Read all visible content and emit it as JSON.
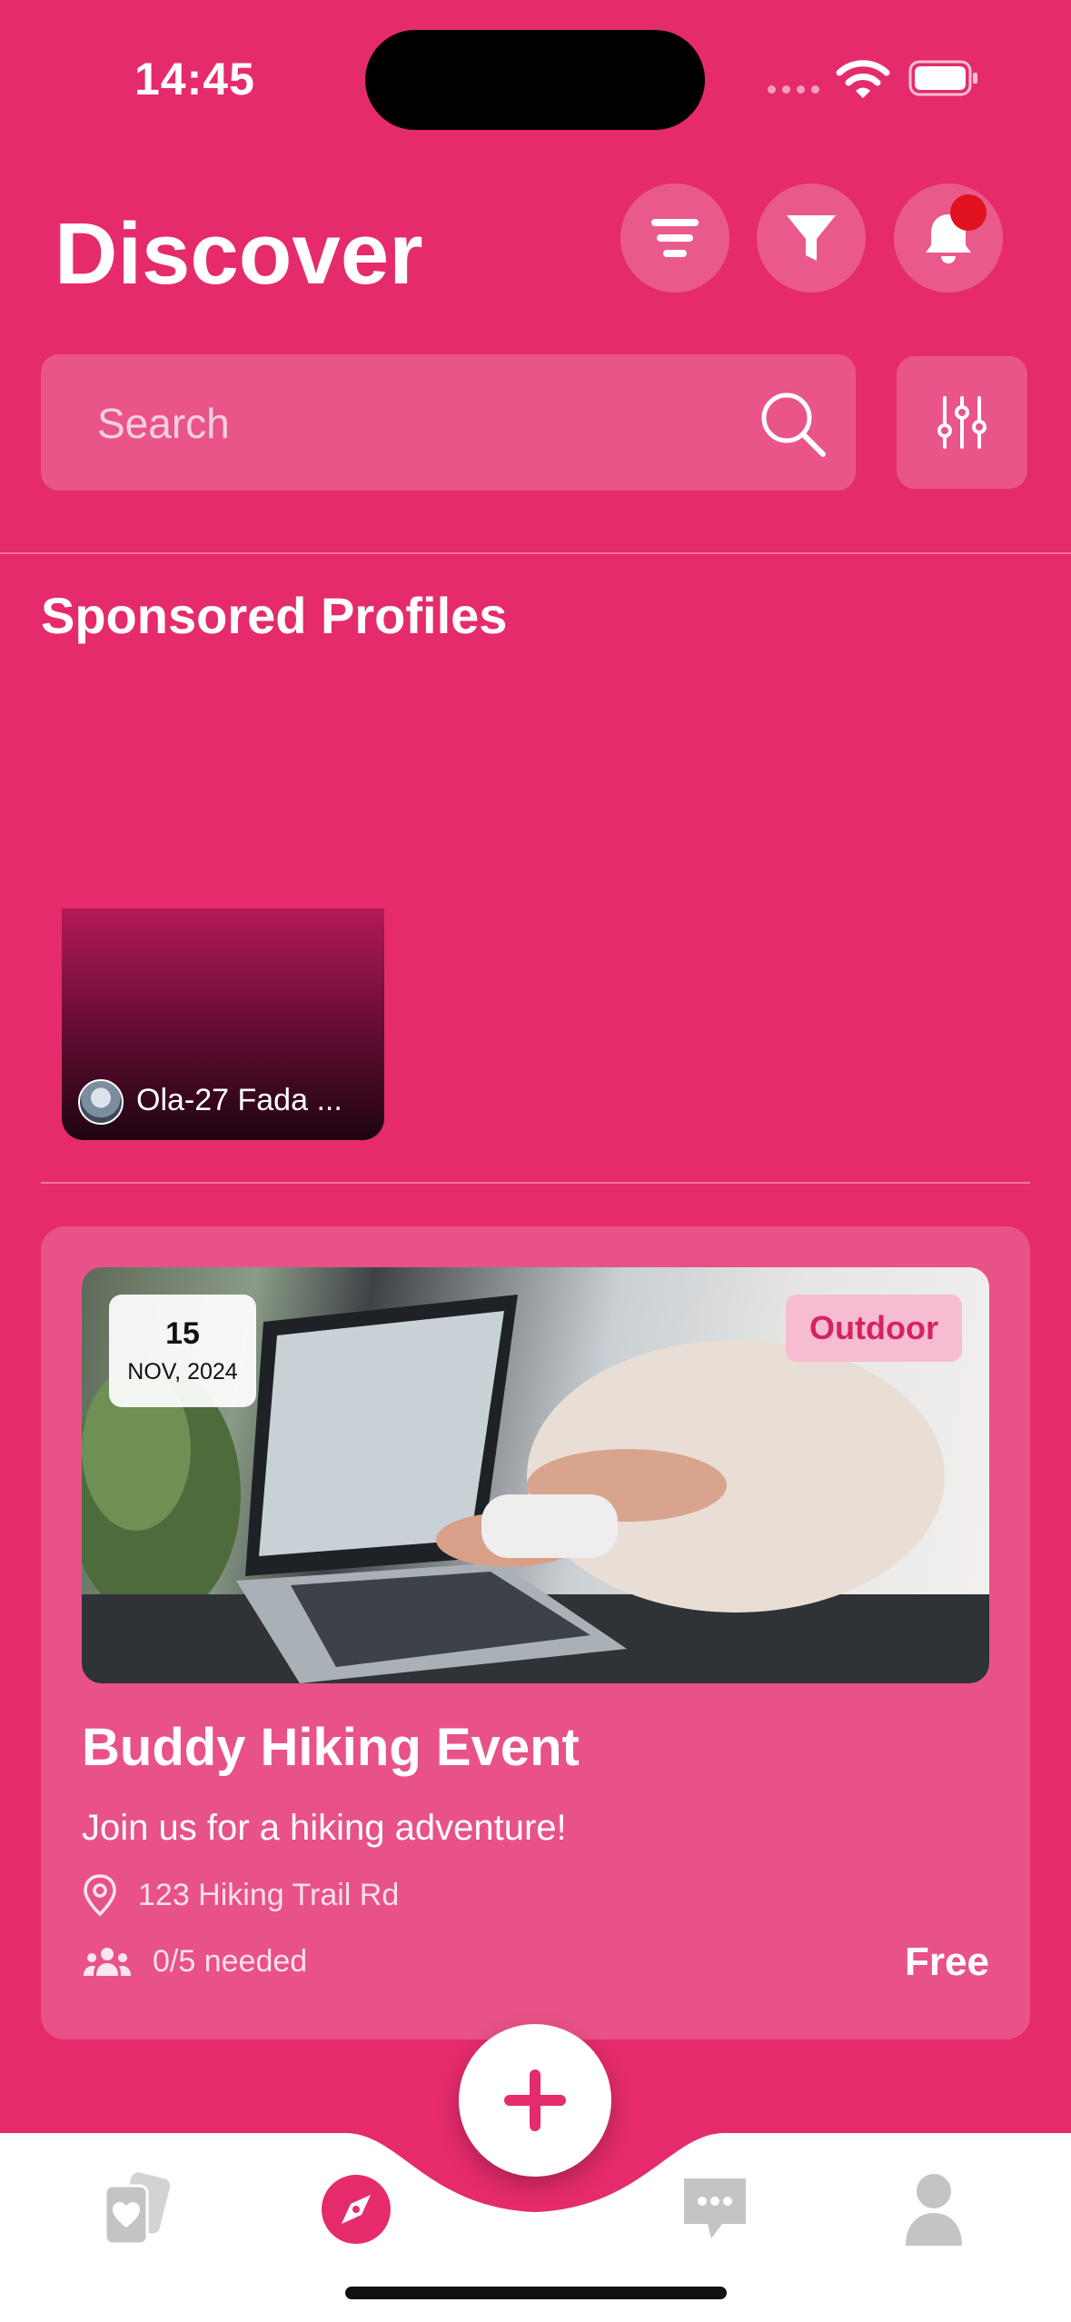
{
  "status_bar": {
    "time": "14:45"
  },
  "header": {
    "title": "Discover"
  },
  "search": {
    "placeholder": "Search"
  },
  "sponsored": {
    "heading": "Sponsored Profiles",
    "profiles": [
      {
        "name": "Ola-27 Fada ..."
      }
    ]
  },
  "event": {
    "date_day": "15",
    "date_month": "NOV, 2024",
    "category": "Outdoor",
    "title": "Buddy Hiking Event",
    "description": "Join us for a hiking adventure!",
    "location": "123 Hiking Trail Rd",
    "needed": "0/5 needed",
    "price": "Free"
  },
  "colors": {
    "background": "#E52B6C",
    "card": "#E85288",
    "badge_bg": "#F7BBD2",
    "badge_text": "#D6235F",
    "notification_dot": "#E0121F",
    "nav_active": "#E52B6C",
    "nav_inactive": "#C4C4C4"
  },
  "icons": {
    "header": [
      "sort-icon",
      "filter-icon",
      "bell-icon"
    ],
    "search": "search-icon",
    "adjust": "sliders-icon",
    "nav": [
      "cards-heart-icon",
      "compass-icon",
      "chat-icon",
      "person-icon"
    ],
    "fab": "plus-icon"
  }
}
